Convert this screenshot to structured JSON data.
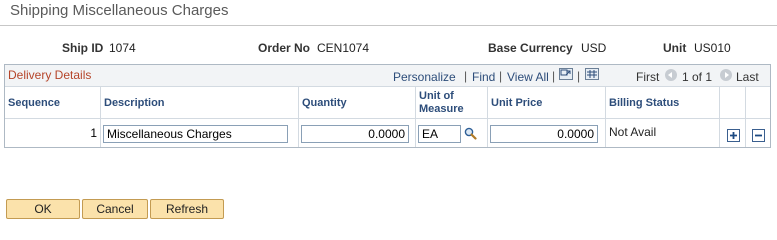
{
  "page": {
    "title": "Shipping Miscellaneous Charges"
  },
  "header": {
    "ship_id_label": "Ship ID",
    "ship_id": "1074",
    "order_no_label": "Order No",
    "order_no": "CEN1074",
    "base_currency_label": "Base Currency",
    "base_currency": "USD",
    "unit_label": "Unit",
    "unit": "US010"
  },
  "grid": {
    "title": "Delivery Details",
    "personalize": "Personalize",
    "find": "Find",
    "view_all": "View All",
    "first": "First",
    "range": "1 of 1",
    "last": "Last",
    "columns": {
      "sequence": "Sequence",
      "description": "Description",
      "quantity": "Quantity",
      "uom_line1": "Unit of",
      "uom_line2": "Measure",
      "unit_price": "Unit Price",
      "billing_status": "Billing Status"
    },
    "rows": [
      {
        "sequence": "1",
        "description": "Miscellaneous Charges",
        "quantity": "0.0000",
        "uom": "EA",
        "unit_price": "0.0000",
        "billing_status": "Not Avail"
      }
    ]
  },
  "buttons": {
    "ok": "OK",
    "cancel": "Cancel",
    "refresh": "Refresh"
  },
  "colors": {
    "accent_title": "#b5452a",
    "link": "#2d4d7a",
    "button_bg": "#fbe2ab"
  }
}
